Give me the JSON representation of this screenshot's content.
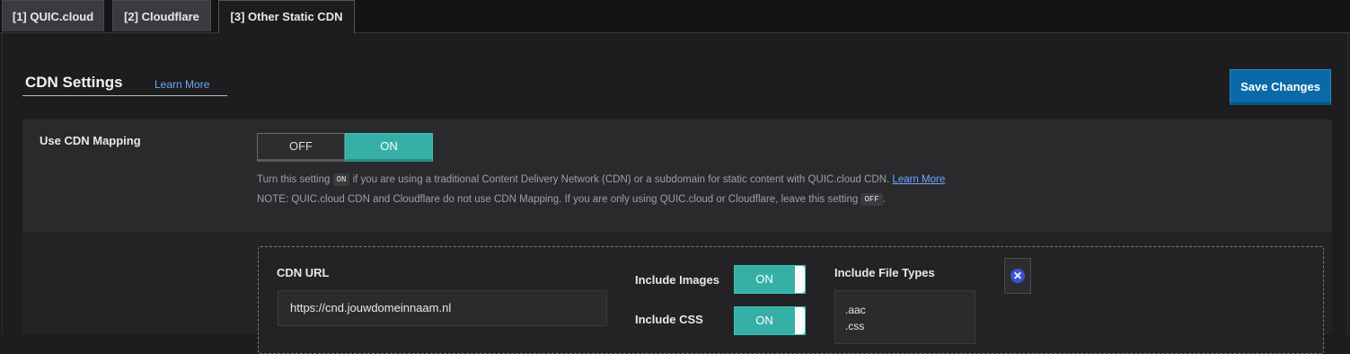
{
  "tabs": [
    {
      "label": "[1] QUIC.cloud"
    },
    {
      "label": "[2] Cloudflare"
    },
    {
      "label": "[3] Other Static CDN"
    }
  ],
  "section": {
    "title": "CDN Settings",
    "learn_more": "Learn More"
  },
  "save_button": "Save Changes",
  "use_cdn_mapping": {
    "label": "Use CDN Mapping",
    "off_label": "OFF",
    "on_label": "ON",
    "selected": "ON",
    "desc1_pre": "Turn this setting",
    "desc1_code": "ON",
    "desc1_post": "if you are using a traditional Content Delivery Network (CDN) or a subdomain for static content with QUIC.cloud CDN.",
    "desc1_link": "Learn More",
    "desc2_pre": "NOTE: QUIC.cloud CDN and Cloudflare do not use CDN Mapping. If you are only using QUIC.cloud or Cloudflare, leave this setting",
    "desc2_code": "OFF",
    "desc2_post": "."
  },
  "mapping": {
    "cdn_url_label": "CDN URL",
    "cdn_url_value": "https://cnd.jouwdomeinnaam.nl",
    "include_images_label": "Include Images",
    "include_images_state": "ON",
    "include_css_label": "Include CSS",
    "include_css_state": "ON",
    "file_types_label": "Include File Types",
    "file_types": [
      ".aac",
      ".css"
    ]
  },
  "colors": {
    "accent_on": "#36b0a6",
    "save_button": "#0a6aa8",
    "link": "#6fa8ff",
    "remove_icon": "#3b53d6"
  }
}
